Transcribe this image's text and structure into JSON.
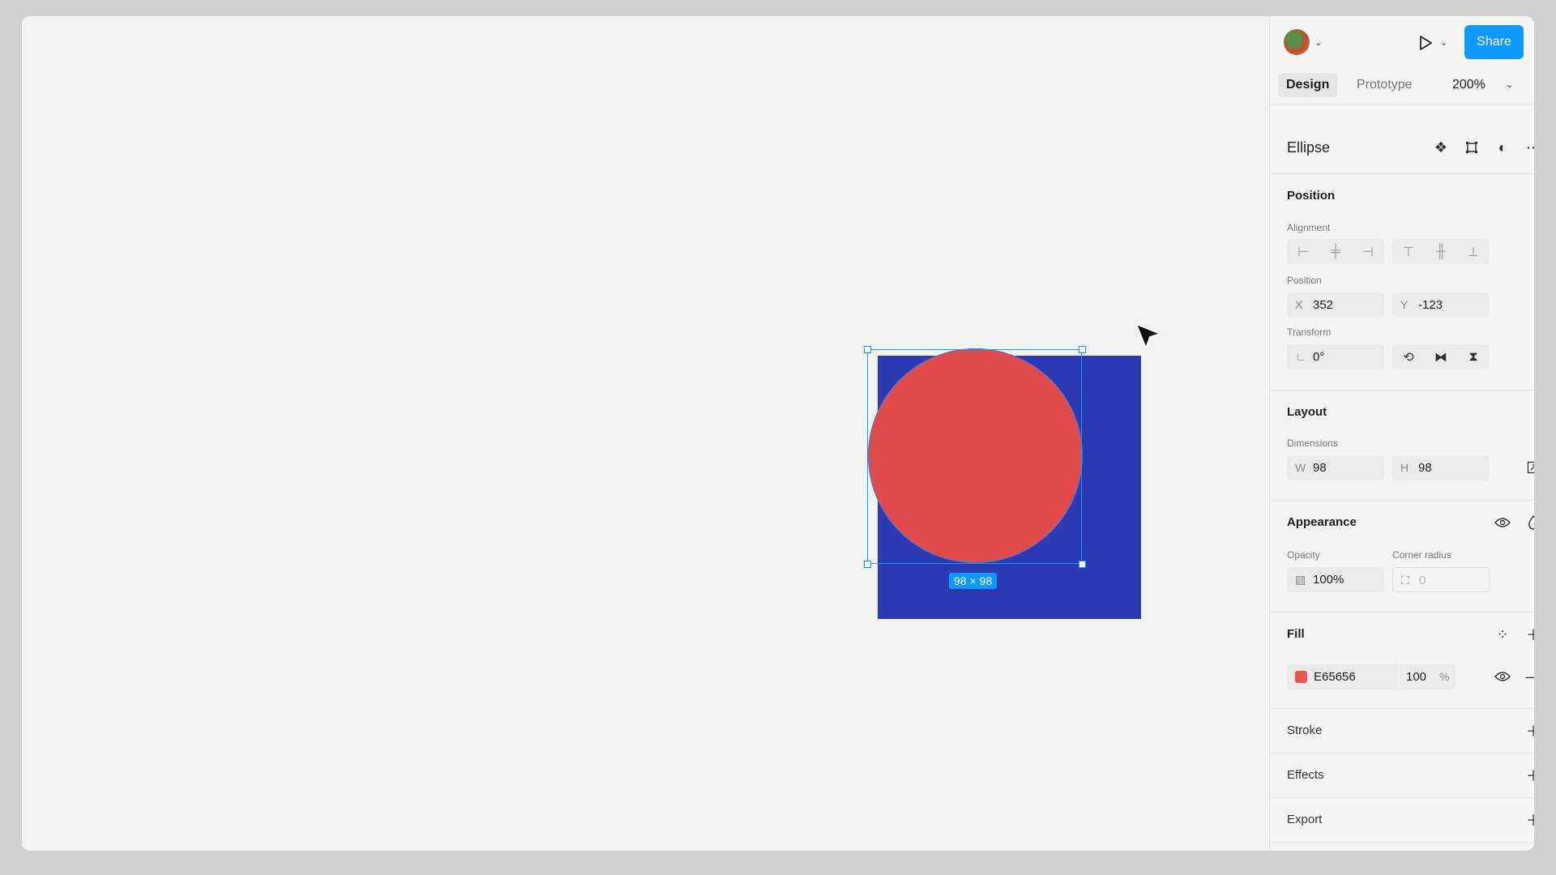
{
  "canvas": {
    "selection_label": "98 × 98",
    "colors": {
      "rect": "#2C3AB3",
      "ellipse": "#E04B4B",
      "selection": "#0D99FF"
    }
  },
  "header": {
    "share_label": "Share",
    "tabs": [
      {
        "label": "Design",
        "active": true
      },
      {
        "label": "Prototype",
        "active": false
      }
    ],
    "zoom": "200%"
  },
  "layer": {
    "name": "Ellipse",
    "actions": [
      "component-icon",
      "frame-icon",
      "mask-icon",
      "more-icon"
    ]
  },
  "position": {
    "title": "Position",
    "alignment_label": "Alignment",
    "position_label": "Position",
    "x_label": "X",
    "x_value": "352",
    "y_label": "Y",
    "y_value": "-123",
    "transform_label": "Transform",
    "rotation_value": "0°"
  },
  "layout": {
    "title": "Layout",
    "dimensions_label": "Dimensions",
    "w_label": "W",
    "w_value": "98",
    "h_label": "H",
    "h_value": "98"
  },
  "appearance": {
    "title": "Appearance",
    "opacity_label": "Opacity",
    "opacity_value": "100%",
    "corner_label": "Corner radius",
    "corner_value": "0"
  },
  "fill": {
    "title": "Fill",
    "hex": "E65656",
    "opacity": "100",
    "percent": "%",
    "swatch": "#E65656"
  },
  "stroke": {
    "title": "Stroke"
  },
  "effects": {
    "title": "Effects"
  },
  "export": {
    "title": "Export"
  }
}
